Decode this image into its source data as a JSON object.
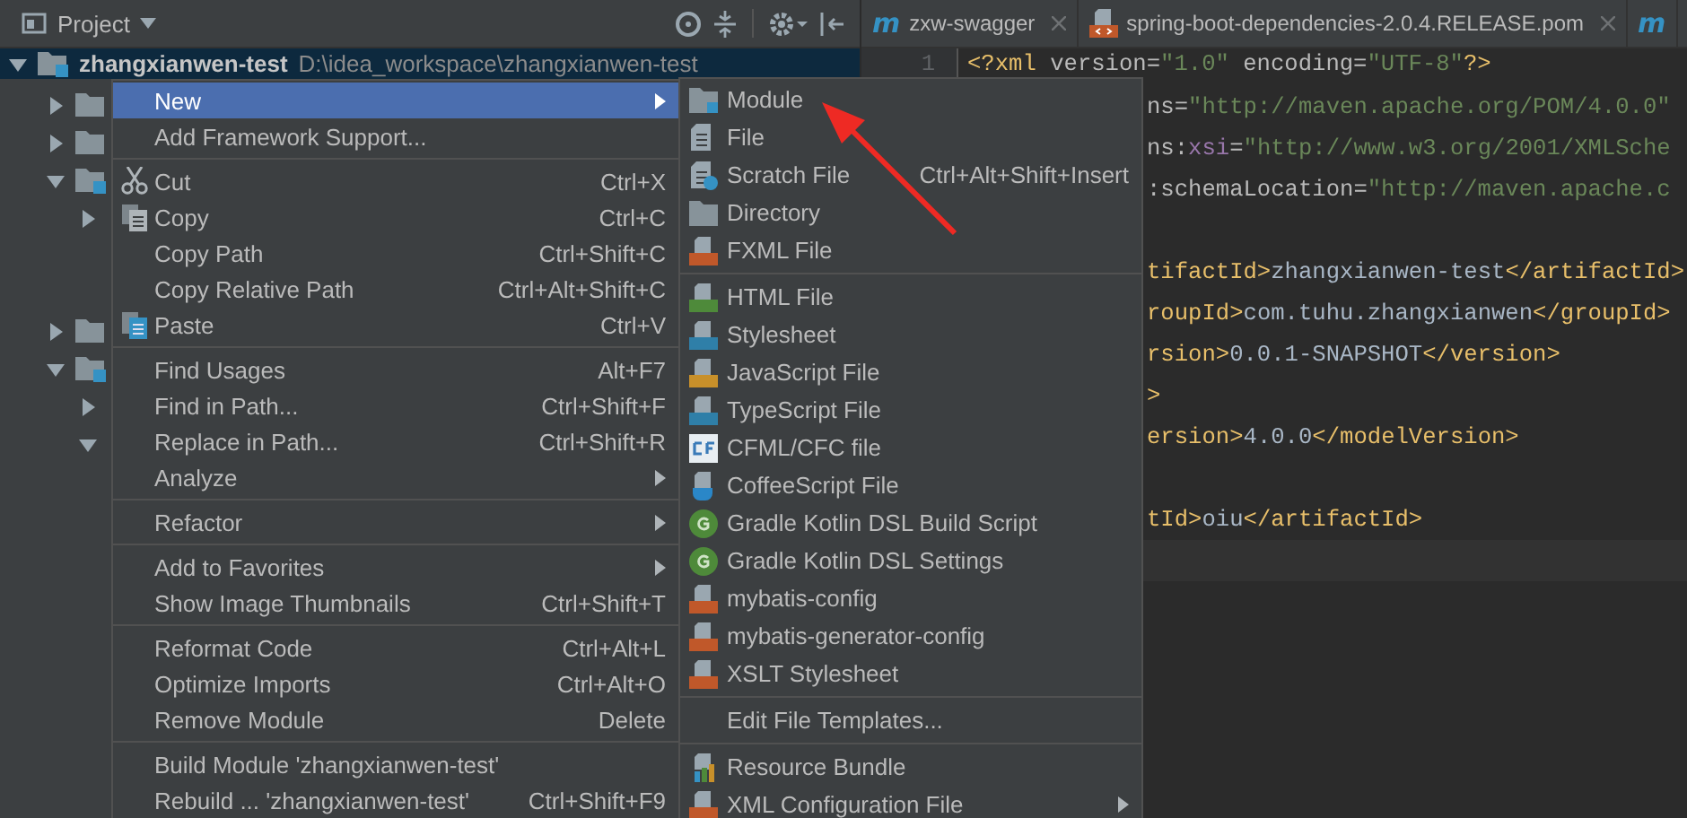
{
  "project_panel": {
    "title": "Project",
    "tree": {
      "name": "zhangxianwen-test",
      "path": "D:\\idea_workspace\\zhangxianwen-test",
      "kind": "module",
      "selected": true,
      "expanded": true,
      "children": [
        {
          "kind": "folder",
          "selected": false,
          "expanded": false
        },
        {
          "kind": "folder",
          "selected": false,
          "expanded": false
        },
        {
          "kind": "module",
          "selected": false,
          "expanded": true,
          "children": [
            {
              "selected": false,
              "expanded": false
            }
          ]
        },
        {
          "kind": "folder",
          "selected": false,
          "expanded": false
        },
        {
          "kind": "module",
          "selected": false,
          "expanded": true,
          "children": [
            {
              "selected": false,
              "expanded": false
            },
            {
              "selected": false,
              "expanded": true
            }
          ]
        }
      ]
    }
  },
  "editor_tabs": [
    {
      "icon": "m",
      "label": "zxw-swagger",
      "kind": "maven"
    },
    {
      "label": "spring-boot-dependencies-2.0.4.RELEASE.pom",
      "kind": "xml"
    },
    {
      "icon": "m",
      "kind": "maven"
    }
  ],
  "editor": {
    "line_number": "1",
    "lines": [
      {
        "kind": "code",
        "segments": [
          {
            "kind": "tag",
            "text": "<?xml"
          },
          {
            "kind": "attr",
            "text": " version="
          },
          {
            "kind": "value",
            "text": "\"1.0\""
          },
          {
            "kind": "attr",
            "text": " encoding="
          },
          {
            "kind": "value",
            "text": "\"UTF-8\""
          },
          {
            "kind": "tag",
            "text": "?>"
          }
        ]
      },
      {
        "kind": "cut",
        "segments": [
          {
            "kind": "attr",
            "text": "ns="
          },
          {
            "kind": "value",
            "text": "\"http://maven.apache.org/POM/4.0.0\""
          }
        ]
      },
      {
        "kind": "cut",
        "segments": [
          {
            "kind": "attr",
            "text": "ns:"
          },
          {
            "kind": "ns",
            "text": "xsi"
          },
          {
            "kind": "attr",
            "text": "="
          },
          {
            "kind": "value",
            "text": "\"http://www.w3.org/2001/XMLSche"
          }
        ]
      },
      {
        "kind": "cut",
        "segments": [
          {
            "kind": "attr",
            "text": ":schemaLocation="
          },
          {
            "kind": "value",
            "text": "\"http://maven.apache.c"
          }
        ]
      },
      {
        "kind": "blank"
      },
      {
        "kind": "cut",
        "segments": [
          {
            "kind": "tag",
            "text": "tifactId>"
          },
          {
            "kind": "text",
            "text": "zhangxianwen-test"
          },
          {
            "kind": "tag",
            "text": "</artifactId>"
          }
        ]
      },
      {
        "kind": "cut",
        "segments": [
          {
            "kind": "tag",
            "text": "roupId>"
          },
          {
            "kind": "text",
            "text": "com.tuhu.zhangxianwen"
          },
          {
            "kind": "tag",
            "text": "</groupId>"
          }
        ]
      },
      {
        "kind": "cut",
        "segments": [
          {
            "kind": "tag",
            "text": "rsion>"
          },
          {
            "kind": "text",
            "text": "0.0.1-SNAPSHOT"
          },
          {
            "kind": "tag",
            "text": "</version>"
          }
        ]
      },
      {
        "kind": "cut",
        "segments": [
          {
            "kind": "tag",
            "text": ">"
          }
        ]
      },
      {
        "kind": "cut",
        "segments": [
          {
            "kind": "tag",
            "text": "ersion>"
          },
          {
            "kind": "text",
            "text": "4.0.0"
          },
          {
            "kind": "tag",
            "text": "</modelVersion>"
          }
        ]
      },
      {
        "kind": "blank"
      },
      {
        "kind": "cut",
        "segments": [
          {
            "kind": "tag",
            "text": "tId>"
          },
          {
            "kind": "text",
            "text": "oiu"
          },
          {
            "kind": "tag",
            "text": "</artifactId>"
          }
        ]
      },
      {
        "kind": "current"
      }
    ]
  },
  "context_menu": {
    "items": [
      {
        "kind": "plain",
        "label": "New",
        "selected": true,
        "submenu": true
      },
      {
        "kind": "plain",
        "label": "Add Framework Support...",
        "selected": false
      },
      {
        "kind": "separator"
      },
      {
        "kind": "cut",
        "label": "Cut",
        "shortcut": "Ctrl+X",
        "selected": false
      },
      {
        "kind": "copy",
        "label": "Copy",
        "shortcut": "Ctrl+C",
        "selected": false
      },
      {
        "kind": "plain",
        "label": "Copy Path",
        "shortcut": "Ctrl+Shift+C",
        "selected": false
      },
      {
        "kind": "plain",
        "label": "Copy Relative Path",
        "shortcut": "Ctrl+Alt+Shift+C",
        "selected": false
      },
      {
        "kind": "paste",
        "label": "Paste",
        "shortcut": "Ctrl+V",
        "selected": false
      },
      {
        "kind": "separator"
      },
      {
        "kind": "plain",
        "label": "Find Usages",
        "shortcut": "Alt+F7",
        "selected": false
      },
      {
        "kind": "plain",
        "label": "Find in Path...",
        "shortcut": "Ctrl+Shift+F",
        "selected": false
      },
      {
        "kind": "plain",
        "label": "Replace in Path...",
        "shortcut": "Ctrl+Shift+R",
        "selected": false
      },
      {
        "kind": "plain",
        "label": "Analyze",
        "selected": false,
        "submenu": true
      },
      {
        "kind": "separator"
      },
      {
        "kind": "plain",
        "label": "Refactor",
        "selected": false,
        "submenu": true
      },
      {
        "kind": "separator"
      },
      {
        "kind": "plain",
        "label": "Add to Favorites",
        "selected": false,
        "submenu": true
      },
      {
        "kind": "plain",
        "label": "Show Image Thumbnails",
        "shortcut": "Ctrl+Shift+T",
        "selected": false
      },
      {
        "kind": "separator"
      },
      {
        "kind": "plain",
        "label": "Reformat Code",
        "shortcut": "Ctrl+Alt+L",
        "selected": false
      },
      {
        "kind": "plain",
        "label": "Optimize Imports",
        "shortcut": "Ctrl+Alt+O",
        "selected": false
      },
      {
        "kind": "plain",
        "label": "Remove Module",
        "shortcut": "Delete",
        "selected": false
      },
      {
        "kind": "separator"
      },
      {
        "kind": "plain",
        "label": "Build Module 'zhangxianwen-test'",
        "selected": false
      },
      {
        "kind": "plain",
        "label": "Rebuild ... 'zhangxianwen-test'",
        "shortcut": "Ctrl+Shift+F9",
        "selected": false
      }
    ]
  },
  "new_submenu": {
    "items": [
      {
        "kind": "module",
        "label": "Module"
      },
      {
        "kind": "file",
        "label": "File"
      },
      {
        "kind": "scratch",
        "label": "Scratch File",
        "shortcut": "Ctrl+Alt+Shift+Insert"
      },
      {
        "kind": "folder",
        "label": "Directory"
      },
      {
        "kind": "xml",
        "label": "FXML File"
      },
      {
        "kind": "separator"
      },
      {
        "kind": "html",
        "label": "HTML File"
      },
      {
        "kind": "css",
        "label": "Stylesheet"
      },
      {
        "kind": "js",
        "label": "JavaScript File"
      },
      {
        "kind": "ts",
        "label": "TypeScript File"
      },
      {
        "kind": "cf",
        "label": "CFML/CFC file"
      },
      {
        "kind": "coffee",
        "label": "CoffeeScript File"
      },
      {
        "kind": "gradle",
        "label": "Gradle Kotlin DSL Build Script"
      },
      {
        "kind": "gradle",
        "label": "Gradle Kotlin DSL Settings"
      },
      {
        "kind": "xml",
        "label": "mybatis-config"
      },
      {
        "kind": "xml",
        "label": "mybatis-generator-config"
      },
      {
        "kind": "xml",
        "label": "XSLT Stylesheet"
      },
      {
        "kind": "separator"
      },
      {
        "kind": "plain",
        "label": "Edit File Templates..."
      },
      {
        "kind": "separator"
      },
      {
        "kind": "bundle",
        "label": "Resource Bundle"
      },
      {
        "kind": "xml",
        "label": "XML Configuration File",
        "submenu": true
      }
    ]
  }
}
